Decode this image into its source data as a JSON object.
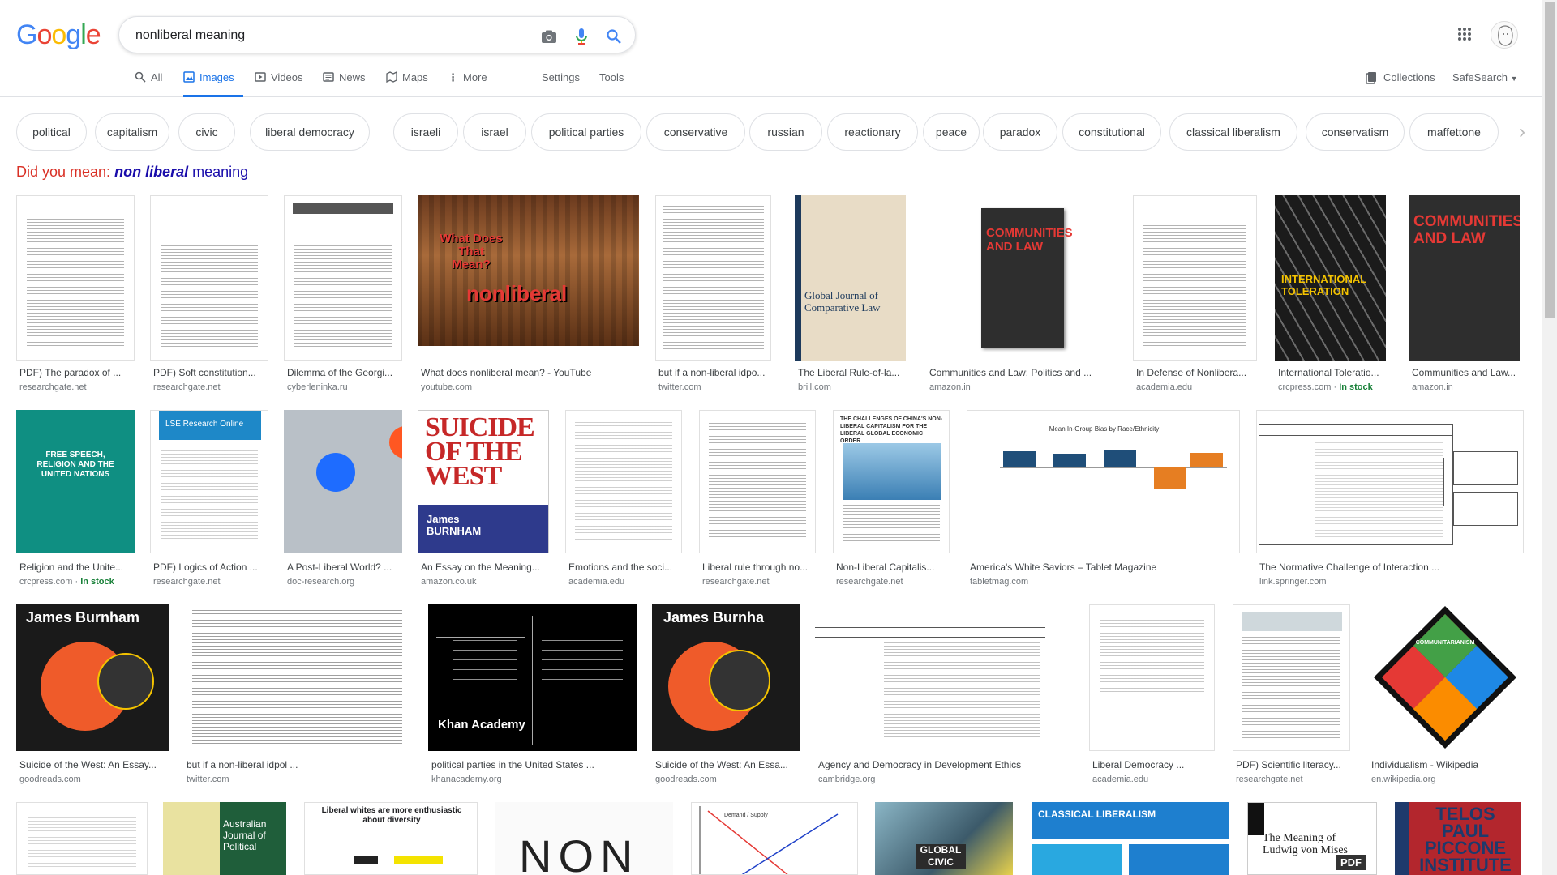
{
  "logo": {
    "letters": [
      "G",
      "o",
      "o",
      "g",
      "l",
      "e"
    ],
    "colors": [
      "#4285f4",
      "#ea4335",
      "#fbbc05",
      "#4285f4",
      "#34a853",
      "#ea4335"
    ]
  },
  "search": {
    "value": "nonliberal meaning",
    "camera_icon": "camera-icon",
    "mic_icon": "mic-icon",
    "search_icon": "search-icon"
  },
  "tabs": [
    {
      "label": "All",
      "icon": "search-icon"
    },
    {
      "label": "Images",
      "icon": "image-icon",
      "active": true
    },
    {
      "label": "Videos",
      "icon": "video-icon"
    },
    {
      "label": "News",
      "icon": "news-icon"
    },
    {
      "label": "Maps",
      "icon": "map-icon"
    },
    {
      "label": "More",
      "icon": "more-vert-icon"
    }
  ],
  "tools": {
    "settings": "Settings",
    "tools": "Tools",
    "collections": "Collections",
    "safesearch": "SafeSearch"
  },
  "chips": [
    "political",
    "capitalism",
    "civic",
    "liberal democracy",
    "israeli",
    "israel",
    "political parties",
    "conservative",
    "russian",
    "reactionary",
    "peace",
    "paradox",
    "constitutional",
    "classical liberalism",
    "conservatism",
    "maffettone"
  ],
  "did_you_mean": {
    "prefix": "Did you mean:",
    "bold": "non liberal",
    "rest": "meaning"
  },
  "row1": [
    {
      "title": "PDF) The paradox of ...",
      "domain": "researchgate.net"
    },
    {
      "title": "PDF) Soft constitution...",
      "domain": "researchgate.net"
    },
    {
      "title": "Dilemma of the Georgi...",
      "domain": "cyberleninka.ru"
    },
    {
      "title": "What does nonliberal mean? - YouTube",
      "domain": "youtube.com",
      "overlay1": "What Does That Mean?",
      "overlay2": "nonliberal"
    },
    {
      "title": "but if a non-liberal idpo...",
      "domain": "twitter.com"
    },
    {
      "title": "The Liberal Rule-of-la...",
      "domain": "brill.com",
      "cover": "Global Journal of Comparative Law"
    },
    {
      "title": "Communities and Law: Politics and ...",
      "domain": "amazon.in",
      "cover": "COMMUNITIES AND LAW"
    },
    {
      "title": "In Defense of Nonlibera...",
      "domain": "academia.edu"
    },
    {
      "title": "International Toleratio...",
      "domain": "crcpress.com",
      "stock": "In stock",
      "cover": "INTERNATIONAL TOLERATION"
    },
    {
      "title": "Communities and Law...",
      "domain": "amazon.in",
      "cover": "COMMUNITIES AND LAW"
    }
  ],
  "row2": [
    {
      "title": "Religion and the Unite...",
      "domain": "crcpress.com",
      "stock": "In stock",
      "cover": "FREE SPEECH, RELIGION AND THE UNITED NATIONS"
    },
    {
      "title": "PDF) Logics of Action ...",
      "domain": "researchgate.net",
      "cover": "LSE Research Online"
    },
    {
      "title": "A Post-Liberal World? ...",
      "domain": "doc-research.org"
    },
    {
      "title": "An Essay on the Meaning...",
      "domain": "amazon.co.uk",
      "cover": "SUICIDE OF THE WEST",
      "author": "James BURNHAM"
    },
    {
      "title": "Emotions and the soci...",
      "domain": "academia.edu"
    },
    {
      "title": "Liberal rule through no...",
      "domain": "researchgate.net"
    },
    {
      "title": "Non-Liberal Capitalis...",
      "domain": "researchgate.net",
      "cover": "THE CHALLENGES OF CHINA'S NON-LIBERAL CAPITALISM FOR THE LIBERAL GLOBAL ECONOMIC ORDER"
    },
    {
      "title": "America's White Saviors – Tablet Magazine",
      "domain": "tabletmag.com",
      "cover": "Mean In-Group Bias by Race/Ethnicity"
    },
    {
      "title": "The Normative Challenge of Interaction ...",
      "domain": "link.springer.com"
    }
  ],
  "row3": [
    {
      "title": "Suicide of the West: An Essay...",
      "domain": "goodreads.com",
      "cover": "James Burnham"
    },
    {
      "title": "but if a non-liberal idpol ...",
      "domain": "twitter.com"
    },
    {
      "title": "political parties in the United States ...",
      "domain": "khanacademy.org",
      "cover": "Khan Academy"
    },
    {
      "title": "Suicide of the West: An Essa...",
      "domain": "goodreads.com",
      "cover": "James Burnha"
    },
    {
      "title": "Agency and Democracy in Development Ethics",
      "domain": "cambridge.org"
    },
    {
      "title": "Liberal Democracy ...",
      "domain": "academia.edu"
    },
    {
      "title": "PDF) Scientific literacy...",
      "domain": "researchgate.net"
    },
    {
      "title": "Individualism - Wikipedia",
      "domain": "en.wikipedia.org",
      "cover": "COMMUNITARIANISM"
    }
  ],
  "row4_covers": [
    "Australian Journal of Political",
    "Liberal whites are more enthusiastic about diversity",
    "NON",
    "Demand / Supply",
    "GLOBAL CIVIC",
    "CLASSICAL LIBERALISM",
    "The Meaning of Ludwig von Mises",
    "TELOS PAUL PICCONE INSTITUTE"
  ]
}
